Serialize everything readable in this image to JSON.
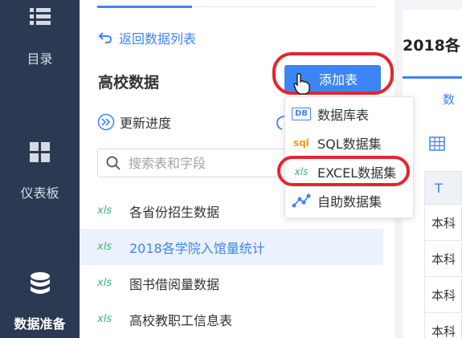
{
  "nav": {
    "items": [
      {
        "label": "目录",
        "icon": "list-icon"
      },
      {
        "label": "仪表板",
        "icon": "dashboard-icon"
      },
      {
        "label": "数据准备",
        "icon": "database-icon"
      }
    ]
  },
  "panel": {
    "back_label": "返回数据列表",
    "title": "高校数据",
    "add_button_label": "添加表",
    "update_label": "更新进度",
    "search_placeholder": "搜索表和字段",
    "tables": [
      {
        "type": "xls",
        "name": "各省份招生数据"
      },
      {
        "type": "xls",
        "name": "2018各学院入馆量统计"
      },
      {
        "type": "xls",
        "name": "图书借阅量数据"
      },
      {
        "type": "xls",
        "name": "高校教职工信息表"
      }
    ]
  },
  "dropdown": {
    "items": [
      {
        "badge": "DB",
        "label": "数据库表"
      },
      {
        "badge": "sql",
        "label": "SQL数据集"
      },
      {
        "badge": "xls",
        "label": "EXCEL数据集"
      },
      {
        "badge": "",
        "label": "自助数据集"
      }
    ]
  },
  "right": {
    "title": "2018各",
    "tab": "数",
    "header": "T",
    "rows": [
      "本科",
      "本科",
      "本科",
      "本科"
    ]
  },
  "colors": {
    "accent": "#3d85f4",
    "nav_bg": "#2b3a52",
    "highlight_ring": "#e4262e",
    "xls_green": "#36b37e"
  }
}
